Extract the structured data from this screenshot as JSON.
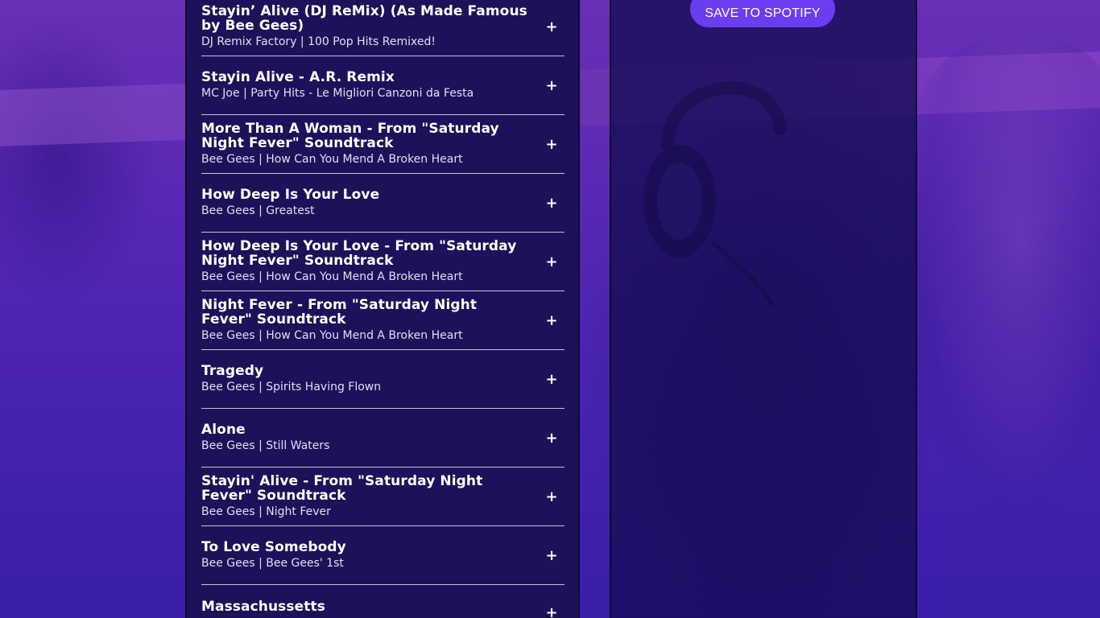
{
  "tracks": [
    {
      "title": "Stayin’ Alive (DJ ReMix) (As Made Famous by Bee Gees)",
      "subtitle": "DJ Remix Factory | 100 Pop Hits Remixed!",
      "add_label": "+"
    },
    {
      "title": "Stayin Alive - A.R. Remix",
      "subtitle": "MC Joe | Party Hits - Le Migliori Canzoni da Festa",
      "add_label": "+"
    },
    {
      "title": "More Than A Woman - From \"Saturday Night Fever\" Soundtrack",
      "subtitle": "Bee Gees | How Can You Mend A Broken Heart",
      "add_label": "+"
    },
    {
      "title": "How Deep Is Your Love",
      "subtitle": "Bee Gees | Greatest",
      "add_label": "+"
    },
    {
      "title": "How Deep Is Your Love - From \"Saturday Night Fever\" Soundtrack",
      "subtitle": "Bee Gees | How Can You Mend A Broken Heart",
      "add_label": "+"
    },
    {
      "title": "Night Fever - From \"Saturday Night Fever\" Soundtrack",
      "subtitle": "Bee Gees | How Can You Mend A Broken Heart",
      "add_label": "+"
    },
    {
      "title": "Tragedy",
      "subtitle": "Bee Gees | Spirits Having Flown",
      "add_label": "+"
    },
    {
      "title": "Alone",
      "subtitle": "Bee Gees | Still Waters",
      "add_label": "+"
    },
    {
      "title": "Stayin' Alive - From \"Saturday Night Fever\" Soundtrack",
      "subtitle": "Bee Gees | Night Fever",
      "add_label": "+"
    },
    {
      "title": "To Love Somebody",
      "subtitle": "Bee Gees | Bee Gees' 1st",
      "add_label": "+"
    },
    {
      "title": "Massachussetts",
      "subtitle": "",
      "add_label": "+"
    }
  ],
  "playlist": {
    "save_label": "SAVE TO SPOTIFY"
  },
  "colors": {
    "panel": "#1d1259",
    "accent": "#6b3df0",
    "background": "#5a2ab8"
  },
  "icons": {
    "add": "plus-icon",
    "decor": "headphones-icon"
  }
}
